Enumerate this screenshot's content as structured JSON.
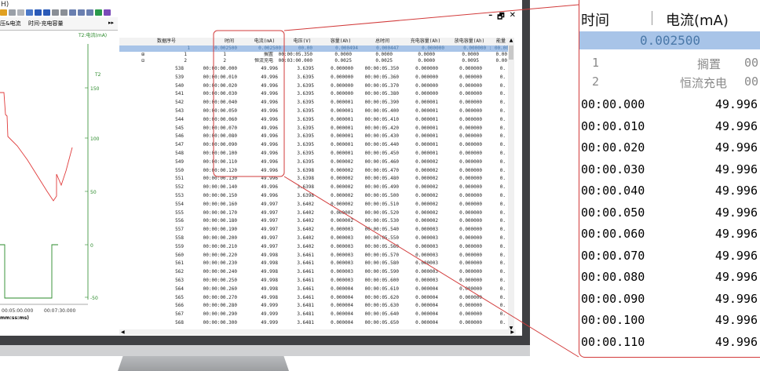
{
  "window": {
    "title_fragment": "H)",
    "controls": [
      "–",
      "🗗",
      "✕"
    ]
  },
  "left_panel": {
    "tabs": [
      "压&电流",
      "时间-充电容量",
      "▸▸"
    ],
    "t2_label": "T2:电流(mA)",
    "axis_label": "T2",
    "y_ticks": [
      "150",
      "100",
      "50",
      "0",
      "-50"
    ],
    "x_ticks": [
      "00:05:00.000",
      "00:07:30.000"
    ],
    "x_unit": "mm:ss:ms)"
  },
  "table": {
    "columns": [
      "数据序号",
      "时间",
      "电流(mA)",
      "电压(V)",
      "容量(Ah)",
      "总时间",
      "充电容量(Ah)",
      "放电容量(Ah)",
      "能量"
    ],
    "selected_row": [
      "1",
      "0.002500",
      "0.002500",
      "00.00",
      "0.000494",
      "0.000447",
      "0.000000",
      "0.000000 : 00.00"
    ],
    "step_rows": [
      {
        "seq": "1",
        "step": "1",
        "mode": "搁置",
        "current": "00:00:05.350",
        "voltage": "0.0000",
        "cap": "0.0000",
        "total": "0.0000",
        "chg": "0.0000",
        "dis": "0.0000",
        "energy": "0.00"
      },
      {
        "seq": "2",
        "step": "2",
        "mode": "恒流充电",
        "current": "00:03:00.000",
        "voltage": "0.0025",
        "cap": "0.0025",
        "total": "0.0000",
        "chg": "0.0095",
        "dis": "0.00",
        "energy": ""
      }
    ],
    "rows": [
      {
        "seq": "538",
        "time": "00:00:00.000",
        "current": "49.996",
        "voltage": "3.6395",
        "cap": "0.000000",
        "total": "00:00:05.350",
        "chg": "0.000000",
        "dis": "0.000000",
        "energy": "0."
      },
      {
        "seq": "539",
        "time": "00:00:00.010",
        "current": "49.996",
        "voltage": "3.6395",
        "cap": "0.000000",
        "total": "00:00:05.360",
        "chg": "0.000000",
        "dis": "0.000000",
        "energy": "0."
      },
      {
        "seq": "540",
        "time": "00:00:00.020",
        "current": "49.996",
        "voltage": "3.6395",
        "cap": "0.000000",
        "total": "00:00:05.370",
        "chg": "0.000000",
        "dis": "0.000000",
        "energy": "0."
      },
      {
        "seq": "541",
        "time": "00:00:00.030",
        "current": "49.996",
        "voltage": "3.6395",
        "cap": "0.000000",
        "total": "00:00:05.380",
        "chg": "0.000000",
        "dis": "0.000000",
        "energy": "0."
      },
      {
        "seq": "542",
        "time": "00:00:00.040",
        "current": "49.996",
        "voltage": "3.6395",
        "cap": "0.000001",
        "total": "00:00:05.390",
        "chg": "0.000001",
        "dis": "0.000000",
        "energy": "0."
      },
      {
        "seq": "543",
        "time": "00:00:00.050",
        "current": "49.996",
        "voltage": "3.6395",
        "cap": "0.000001",
        "total": "00:00:05.400",
        "chg": "0.000001",
        "dis": "0.000000",
        "energy": "0."
      },
      {
        "seq": "544",
        "time": "00:00:00.060",
        "current": "49.996",
        "voltage": "3.6395",
        "cap": "0.000001",
        "total": "00:00:05.410",
        "chg": "0.000001",
        "dis": "0.000000",
        "energy": "0."
      },
      {
        "seq": "545",
        "time": "00:00:00.070",
        "current": "49.996",
        "voltage": "3.6395",
        "cap": "0.000001",
        "total": "00:00:05.420",
        "chg": "0.000001",
        "dis": "0.000000",
        "energy": "0."
      },
      {
        "seq": "546",
        "time": "00:00:00.080",
        "current": "49.996",
        "voltage": "3.6395",
        "cap": "0.000001",
        "total": "00:00:05.430",
        "chg": "0.000001",
        "dis": "0.000000",
        "energy": "0."
      },
      {
        "seq": "547",
        "time": "00:00:00.090",
        "current": "49.996",
        "voltage": "3.6395",
        "cap": "0.000001",
        "total": "00:00:05.440",
        "chg": "0.000001",
        "dis": "0.000000",
        "energy": "0."
      },
      {
        "seq": "548",
        "time": "00:00:00.100",
        "current": "49.996",
        "voltage": "3.6395",
        "cap": "0.000001",
        "total": "00:00:05.450",
        "chg": "0.000001",
        "dis": "0.000000",
        "energy": "0."
      },
      {
        "seq": "549",
        "time": "00:00:00.110",
        "current": "49.996",
        "voltage": "3.6395",
        "cap": "0.000002",
        "total": "00:00:05.460",
        "chg": "0.000002",
        "dis": "0.000000",
        "energy": "0."
      },
      {
        "seq": "550",
        "time": "00:00:00.120",
        "current": "49.996",
        "voltage": "3.6398",
        "cap": "0.000002",
        "total": "00:00:05.470",
        "chg": "0.000002",
        "dis": "0.000000",
        "energy": "0."
      },
      {
        "seq": "551",
        "time": "00:00:00.130",
        "current": "49.996",
        "voltage": "3.6398",
        "cap": "0.000002",
        "total": "00:00:05.480",
        "chg": "0.000002",
        "dis": "0.000000",
        "energy": "0."
      },
      {
        "seq": "552",
        "time": "00:00:00.140",
        "current": "49.996",
        "voltage": "3.6398",
        "cap": "0.000002",
        "total": "00:00:05.490",
        "chg": "0.000002",
        "dis": "0.000000",
        "energy": "0."
      },
      {
        "seq": "553",
        "time": "00:00:00.150",
        "current": "49.996",
        "voltage": "3.6398",
        "cap": "0.000002",
        "total": "00:00:05.500",
        "chg": "0.000002",
        "dis": "0.000000",
        "energy": "0."
      },
      {
        "seq": "554",
        "time": "00:00:00.160",
        "current": "49.997",
        "voltage": "3.6402",
        "cap": "0.000002",
        "total": "00:00:05.510",
        "chg": "0.000002",
        "dis": "0.000000",
        "energy": "0."
      },
      {
        "seq": "555",
        "time": "00:00:00.170",
        "current": "49.997",
        "voltage": "3.6402",
        "cap": "0.000002",
        "total": "00:00:05.520",
        "chg": "0.000002",
        "dis": "0.000000",
        "energy": "0."
      },
      {
        "seq": "556",
        "time": "00:00:00.180",
        "current": "49.997",
        "voltage": "3.6402",
        "cap": "0.000002",
        "total": "00:00:05.530",
        "chg": "0.000002",
        "dis": "0.000000",
        "energy": "0."
      },
      {
        "seq": "557",
        "time": "00:00:00.190",
        "current": "49.997",
        "voltage": "3.6402",
        "cap": "0.000003",
        "total": "00:00:05.540",
        "chg": "0.000003",
        "dis": "0.000000",
        "energy": "0."
      },
      {
        "seq": "558",
        "time": "00:00:00.200",
        "current": "49.997",
        "voltage": "3.6402",
        "cap": "0.000003",
        "total": "00:00:05.550",
        "chg": "0.000003",
        "dis": "0.000000",
        "energy": "0."
      },
      {
        "seq": "559",
        "time": "00:00:00.210",
        "current": "49.997",
        "voltage": "3.6402",
        "cap": "0.000003",
        "total": "00:00:05.560",
        "chg": "0.000003",
        "dis": "0.000000",
        "energy": "0."
      },
      {
        "seq": "560",
        "time": "00:00:00.220",
        "current": "49.998",
        "voltage": "3.6461",
        "cap": "0.000003",
        "total": "00:00:05.570",
        "chg": "0.000003",
        "dis": "0.000000",
        "energy": "0."
      },
      {
        "seq": "561",
        "time": "00:00:00.230",
        "current": "49.998",
        "voltage": "3.6461",
        "cap": "0.000003",
        "total": "00:00:05.580",
        "chg": "0.000003",
        "dis": "0.000000",
        "energy": "0."
      },
      {
        "seq": "562",
        "time": "00:00:00.240",
        "current": "49.998",
        "voltage": "3.6461",
        "cap": "0.000003",
        "total": "00:00:05.590",
        "chg": "0.000003",
        "dis": "0.000000",
        "energy": "0."
      },
      {
        "seq": "563",
        "time": "00:00:00.250",
        "current": "49.998",
        "voltage": "3.6461",
        "cap": "0.000003",
        "total": "00:00:05.600",
        "chg": "0.000003",
        "dis": "0.000000",
        "energy": "0."
      },
      {
        "seq": "564",
        "time": "00:00:00.260",
        "current": "49.998",
        "voltage": "3.6461",
        "cap": "0.000004",
        "total": "00:00:05.610",
        "chg": "0.000004",
        "dis": "0.000000",
        "energy": "0."
      },
      {
        "seq": "565",
        "time": "00:00:00.270",
        "current": "49.998",
        "voltage": "3.6461",
        "cap": "0.000004",
        "total": "00:00:05.620",
        "chg": "0.000004",
        "dis": "0.000000",
        "energy": "0."
      },
      {
        "seq": "566",
        "time": "00:00:00.280",
        "current": "49.999",
        "voltage": "3.6481",
        "cap": "0.000004",
        "total": "00:00:05.630",
        "chg": "0.000004",
        "dis": "0.000000",
        "energy": "0."
      },
      {
        "seq": "567",
        "time": "00:00:00.290",
        "current": "49.999",
        "voltage": "3.6481",
        "cap": "0.000004",
        "total": "00:00:05.640",
        "chg": "0.000004",
        "dis": "0.000000",
        "energy": "0."
      },
      {
        "seq": "568",
        "time": "00:00:00.300",
        "current": "49.999",
        "voltage": "3.6481",
        "cap": "0.000004",
        "total": "00:00:05.650",
        "chg": "0.000004",
        "dis": "0.000000",
        "energy": "0."
      }
    ]
  },
  "zoom_panel": {
    "col_time": "时间",
    "col_current": "电流(mA)",
    "selected_value": "0.002500",
    "step_rows": [
      {
        "seq": "1",
        "mode": "搁置",
        "tail": "00"
      },
      {
        "seq": "2",
        "mode": "恒流充电",
        "tail": "00"
      }
    ],
    "rows": [
      {
        "time": "00:00.000",
        "current": "49.996"
      },
      {
        "time": "00:00.010",
        "current": "49.996"
      },
      {
        "time": "00:00.020",
        "current": "49.996"
      },
      {
        "time": "00:00.030",
        "current": "49.996"
      },
      {
        "time": "00:00.040",
        "current": "49.996"
      },
      {
        "time": "00:00.050",
        "current": "49.996"
      },
      {
        "time": "00:00.060",
        "current": "49.996"
      },
      {
        "time": "00:00.070",
        "current": "49.996"
      },
      {
        "time": "00:00.080",
        "current": "49.996"
      },
      {
        "time": "00:00.090",
        "current": "49.996"
      },
      {
        "time": "00:00.100",
        "current": "49.996"
      },
      {
        "time": "00:00.110",
        "current": "49.996"
      }
    ]
  },
  "colors": {
    "highlight": "#d23b3b",
    "selection": "#a8c4e8",
    "curve": "#e03b3b",
    "axis_green": "#2a8a2a"
  }
}
